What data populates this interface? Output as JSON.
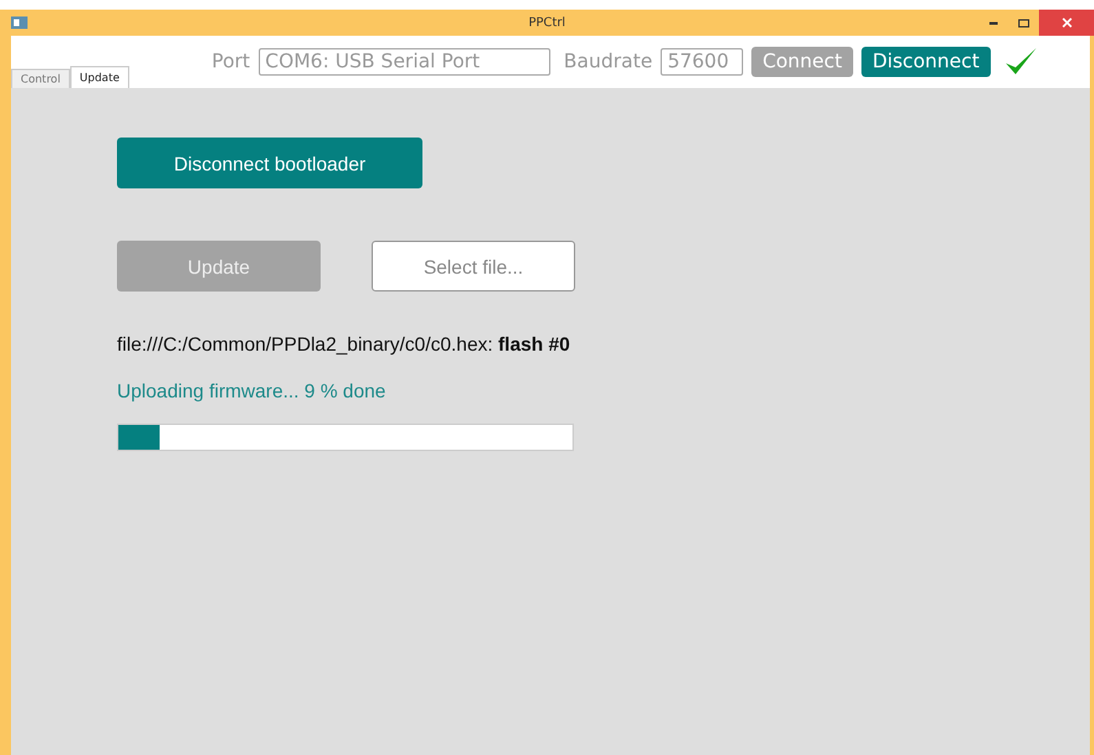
{
  "window": {
    "title": "PPCtrl"
  },
  "tabs": [
    {
      "label": "Control",
      "selected": false
    },
    {
      "label": "Update",
      "selected": true
    }
  ],
  "connection": {
    "port_label": "Port",
    "port": "COM6: USB Serial Port",
    "baud_label": "Baudrate",
    "baud": "57600",
    "connect": {
      "label": "Connect",
      "disabled": true
    },
    "disconnect": {
      "label": "Disconnect",
      "disabled": false
    },
    "connected": true
  },
  "update_panel": {
    "bootloader_button": "Disconnect bootloader",
    "update_button": {
      "label": "Update",
      "disabled": true
    },
    "select_button": "Select file...",
    "file_line": "file:///C:/Common/PPDla2_binary/c0/c0.hex: **flash #0**",
    "status": "Uploading firmware... 9 % done",
    "progress": {
      "level": 0.09
    }
  }
}
